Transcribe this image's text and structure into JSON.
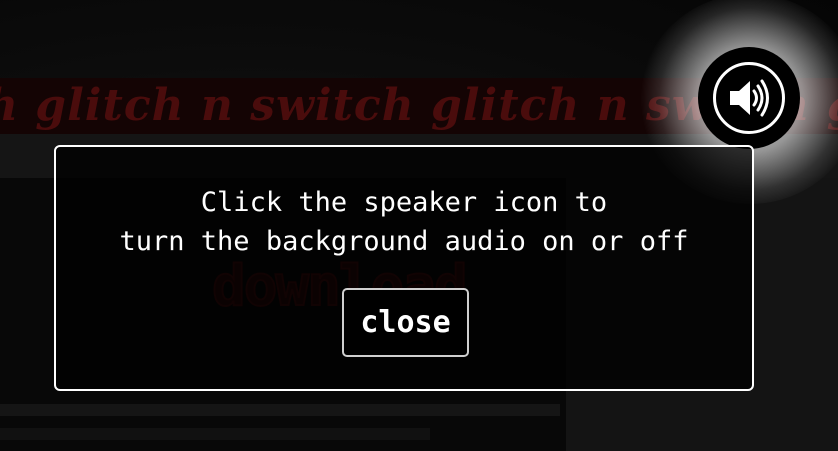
{
  "background": {
    "marquee_text": "h glitch n switch glitch n switch glitch n switch",
    "download_text": "download"
  },
  "speaker": {
    "icon": "speaker-volume-icon",
    "state": "on"
  },
  "modal": {
    "line1": "Click the speaker icon to",
    "line2": "turn the background audio on or off",
    "close_label": "close"
  },
  "colors": {
    "accent_dark_red": "#4a0c0c",
    "modal_border": "#ffffff",
    "text": "#ffffff"
  }
}
